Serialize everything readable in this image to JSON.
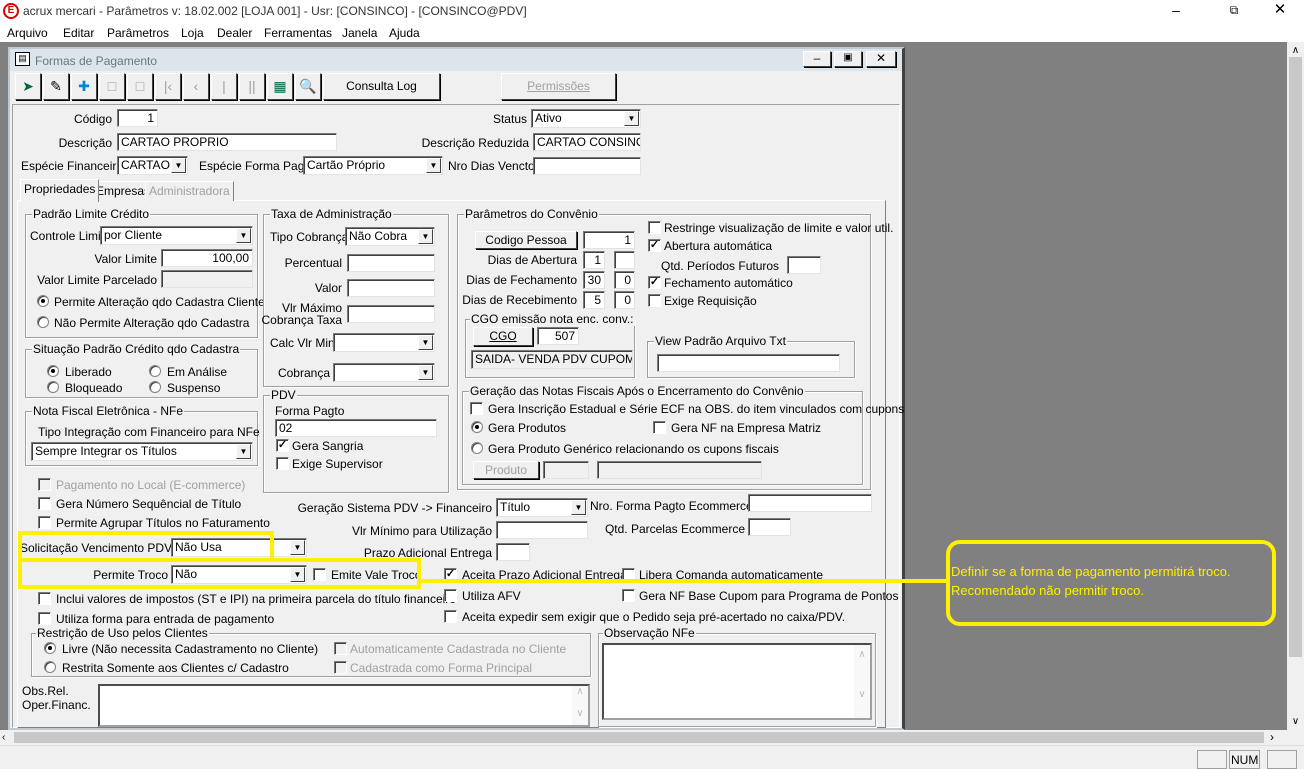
{
  "app": {
    "title": "acrux mercari - Parâmetros  v: 18.02.002   [LOJA 001] - Usr: [CONSINCO] - [CONSINCO@PDV]",
    "logo": "E"
  },
  "menu": [
    "Arquivo",
    "Editar",
    "Parâmetros",
    "Loja",
    "Dealer",
    "Ferramentas",
    "Janela",
    "Ajuda"
  ],
  "window": {
    "title": "Formas de Pagamento"
  },
  "toolbar": {
    "consulta_log": "Consulta Log",
    "permissoes": "Permissões"
  },
  "header": {
    "codigo_label": "Código",
    "codigo": "1",
    "status_label": "Status",
    "status": "Ativo",
    "descricao_label": "Descrição",
    "descricao": "CARTAO PROPRIO",
    "descricao_reduzida_label": "Descrição Reduzida",
    "descricao_reduzida": "CARTAO CONSINCO",
    "especie_financeira_label": "Espécie Financeira",
    "especie_financeira": "CARTAO",
    "especie_forma_label": "Espécie Forma Pagto",
    "especie_forma": "Cartão Próprio",
    "nro_dias_label": "Nro Dias Vencto",
    "nro_dias": ""
  },
  "tabs": [
    "Propriedades",
    "Empresas",
    "Administradora"
  ],
  "limite": {
    "title": "Padrão Limite Crédito",
    "controle_label": "Controle Limite",
    "controle": "por Cliente",
    "valor_label": "Valor Limite",
    "valor": "100,00",
    "parcelado_label": "Valor Limite Parcelado",
    "radio1": "Permite Alteração qdo Cadastra Cliente",
    "radio2": "Não Permite Alteração qdo Cadastra"
  },
  "situacao": {
    "title": "Situação Padrão Crédito qdo Cadastra",
    "liberado": "Liberado",
    "em_analise": "Em Análise",
    "bloqueado": "Bloqueado",
    "suspenso": "Suspenso"
  },
  "nfe": {
    "title": "Nota Fiscal Eletrônica - NFe",
    "tipo_label": "Tipo Integração com Financeiro para NFe",
    "tipo": "Sempre Integrar os Títulos"
  },
  "taxa": {
    "title": "Taxa de Administração",
    "tipo_label": "Tipo Cobrança",
    "tipo": "Não Cobra",
    "percentual_label": "Percentual",
    "valor_label": "Valor",
    "vlr_max_label1": "Vlr Máximo",
    "vlr_max_label2": "Cobrança Taxa",
    "calc_label": "Calc Vlr Min",
    "cobranca_label": "Cobrança"
  },
  "pdv": {
    "title": "PDV",
    "forma_label": "Forma Pagto",
    "forma": "02",
    "gera_sangria": "Gera Sangria",
    "exige_supervisor": "Exige Supervisor"
  },
  "convenio": {
    "title": "Parâmetros do Convênio",
    "codigo_pessoa_btn": "Codigo Pessoa",
    "codigo_pessoa": "1",
    "abertura_label": "Dias de Abertura",
    "abertura1": "1",
    "abertura2": "",
    "fechamento_label": "Dias de Fechamento",
    "fechamento1": "30",
    "fechamento2": "0",
    "recebimento_label": "Dias de Recebimento",
    "recebimento1": "5",
    "recebimento2": "0",
    "restringe": "Restringe visualização de limite e valor util.",
    "abertura_auto": "Abertura automática",
    "qtd_periodos_label": "Qtd. Períodos Futuros",
    "fechamento_auto": "Fechamento automático",
    "exige_requisicao": "Exige Requisição",
    "cgo_title": "CGO emissão nota enc. conv.:",
    "cgo_btn": "CGO",
    "cgo": "507",
    "cgo_desc": "SAIDA- VENDA PDV CUPOM FI!",
    "view_title": "View Padrão Arquivo Txt"
  },
  "geracao": {
    "title": "Geração das Notas Fiscais Após o Encerramento do Convênio",
    "gera_inscricao": "Gera Inscrição Estadual e Série ECF na OBS. do item vinculados com cupons",
    "gera_produtos": "Gera Produtos",
    "gera_nf_matriz": "Gera NF na Empresa Matriz",
    "gera_generico": "Gera Produto Genérico relacionando os cupons fiscais",
    "produto_btn": "Produto"
  },
  "opcoes": {
    "pagamento_local": "Pagamento no Local (E-commerce)",
    "gera_numero": "Gera Número Sequêncial de Título",
    "permite_agrupar": "Permite Agrupar Títulos no Faturamento",
    "solicitacao_label": "Solicitação Vencimento PDV",
    "solicitacao": "Não Usa",
    "troco_label": "Permite Troco",
    "troco": "Não",
    "emite_vale": "Emite Vale Troco",
    "inclui_impostos": "Inclui valores de impostos (ST e IPI) na primeira parcela do título financeiro",
    "utiliza_entrada": "Utiliza forma para entrada de pagamento",
    "geracao_pdv_label": "Geração Sistema PDV -> Financeiro",
    "geracao_pdv": "Título",
    "vlr_minimo_label": "Vlr Mínimo para Utilização",
    "prazo_label": "Prazo Adicional Entrega",
    "nro_ecommerce_label": "Nro. Forma Pagto Ecommerce",
    "qtd_parcelas_label": "Qtd. Parcelas Ecommerce",
    "aceita_prazo": "Aceita Prazo Adicional Entrega",
    "libera_comanda": "Libera Comanda automaticamente",
    "utiliza_afv": "Utiliza AFV",
    "gera_nf_pontos": "Gera NF Base Cupom para Programa de Pontos",
    "aceita_expedir": "Aceita expedir sem exigir que o Pedido seja pré-acertado no caixa/PDV."
  },
  "restricao": {
    "title": "Restrição de Uso pelos Clientes",
    "livre": "Livre (Não necessita Cadastramento no Cliente)",
    "restrita": "Restrita Somente aos Clientes c/ Cadastro",
    "auto_cadastrada": "Automaticamente Cadastrada no Cliente",
    "principal": "Cadastrada como Forma Principal"
  },
  "obs": {
    "label1": "Obs.Rel.",
    "label2": "Oper.Financ.",
    "nfe_title": "Observação NFe"
  },
  "callout": {
    "line1": "Definir se a forma de pagamento permitirá troco.",
    "line2": "Recomendado não permitir troco.",
    "color": "#ffef00"
  },
  "statusbar": {
    "num": "NUM"
  }
}
